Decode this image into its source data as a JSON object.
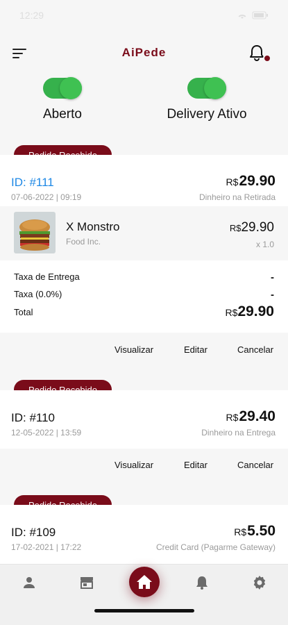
{
  "status_bar": {
    "time": "12:29"
  },
  "header": {
    "title": "AiPede"
  },
  "toggles": [
    {
      "label": "Aberto",
      "on": true
    },
    {
      "label": "Delivery Ativo",
      "on": true
    }
  ],
  "orders": [
    {
      "badge": "Pedido Recebido",
      "id": "ID: #111",
      "date": "07-06-2022 | 09:19",
      "currency": "R$",
      "total": "29.90",
      "payment": "Dinheiro na Retirada",
      "items": [
        {
          "name": "X Monstro",
          "store": "Food Inc.",
          "currency": "R$",
          "price": "29.90",
          "qty": "x 1.0"
        }
      ],
      "summary": {
        "delivery_label": "Taxa de Entrega",
        "delivery_value": "-",
        "tax_label": "Taxa (0.0%)",
        "tax_value": "-",
        "total_label": "Total",
        "total_currency": "R$",
        "total_value": "29.90"
      }
    },
    {
      "badge": "Pedido Recebido",
      "id": "ID: #110",
      "date": "12-05-2022 | 13:59",
      "currency": "R$",
      "total": "29.40",
      "payment": "Dinheiro na Entrega"
    },
    {
      "badge": "Pedido Recebido",
      "id": "ID: #109",
      "date": "17-02-2021 | 17:22",
      "currency": "R$",
      "total": "5.50",
      "payment": "Credit Card (Pagarme Gateway)"
    }
  ],
  "actions": {
    "view": "Visualizar",
    "edit": "Editar",
    "cancel": "Cancelar"
  },
  "tab_bar": {
    "items": [
      "profile-icon",
      "store-icon",
      "home-icon",
      "bell-icon",
      "gear-icon"
    ],
    "active": "home-icon"
  },
  "colors": {
    "brand": "#7a0c1a",
    "toggle_on": "#3fc152",
    "link": "#1e88e5"
  }
}
